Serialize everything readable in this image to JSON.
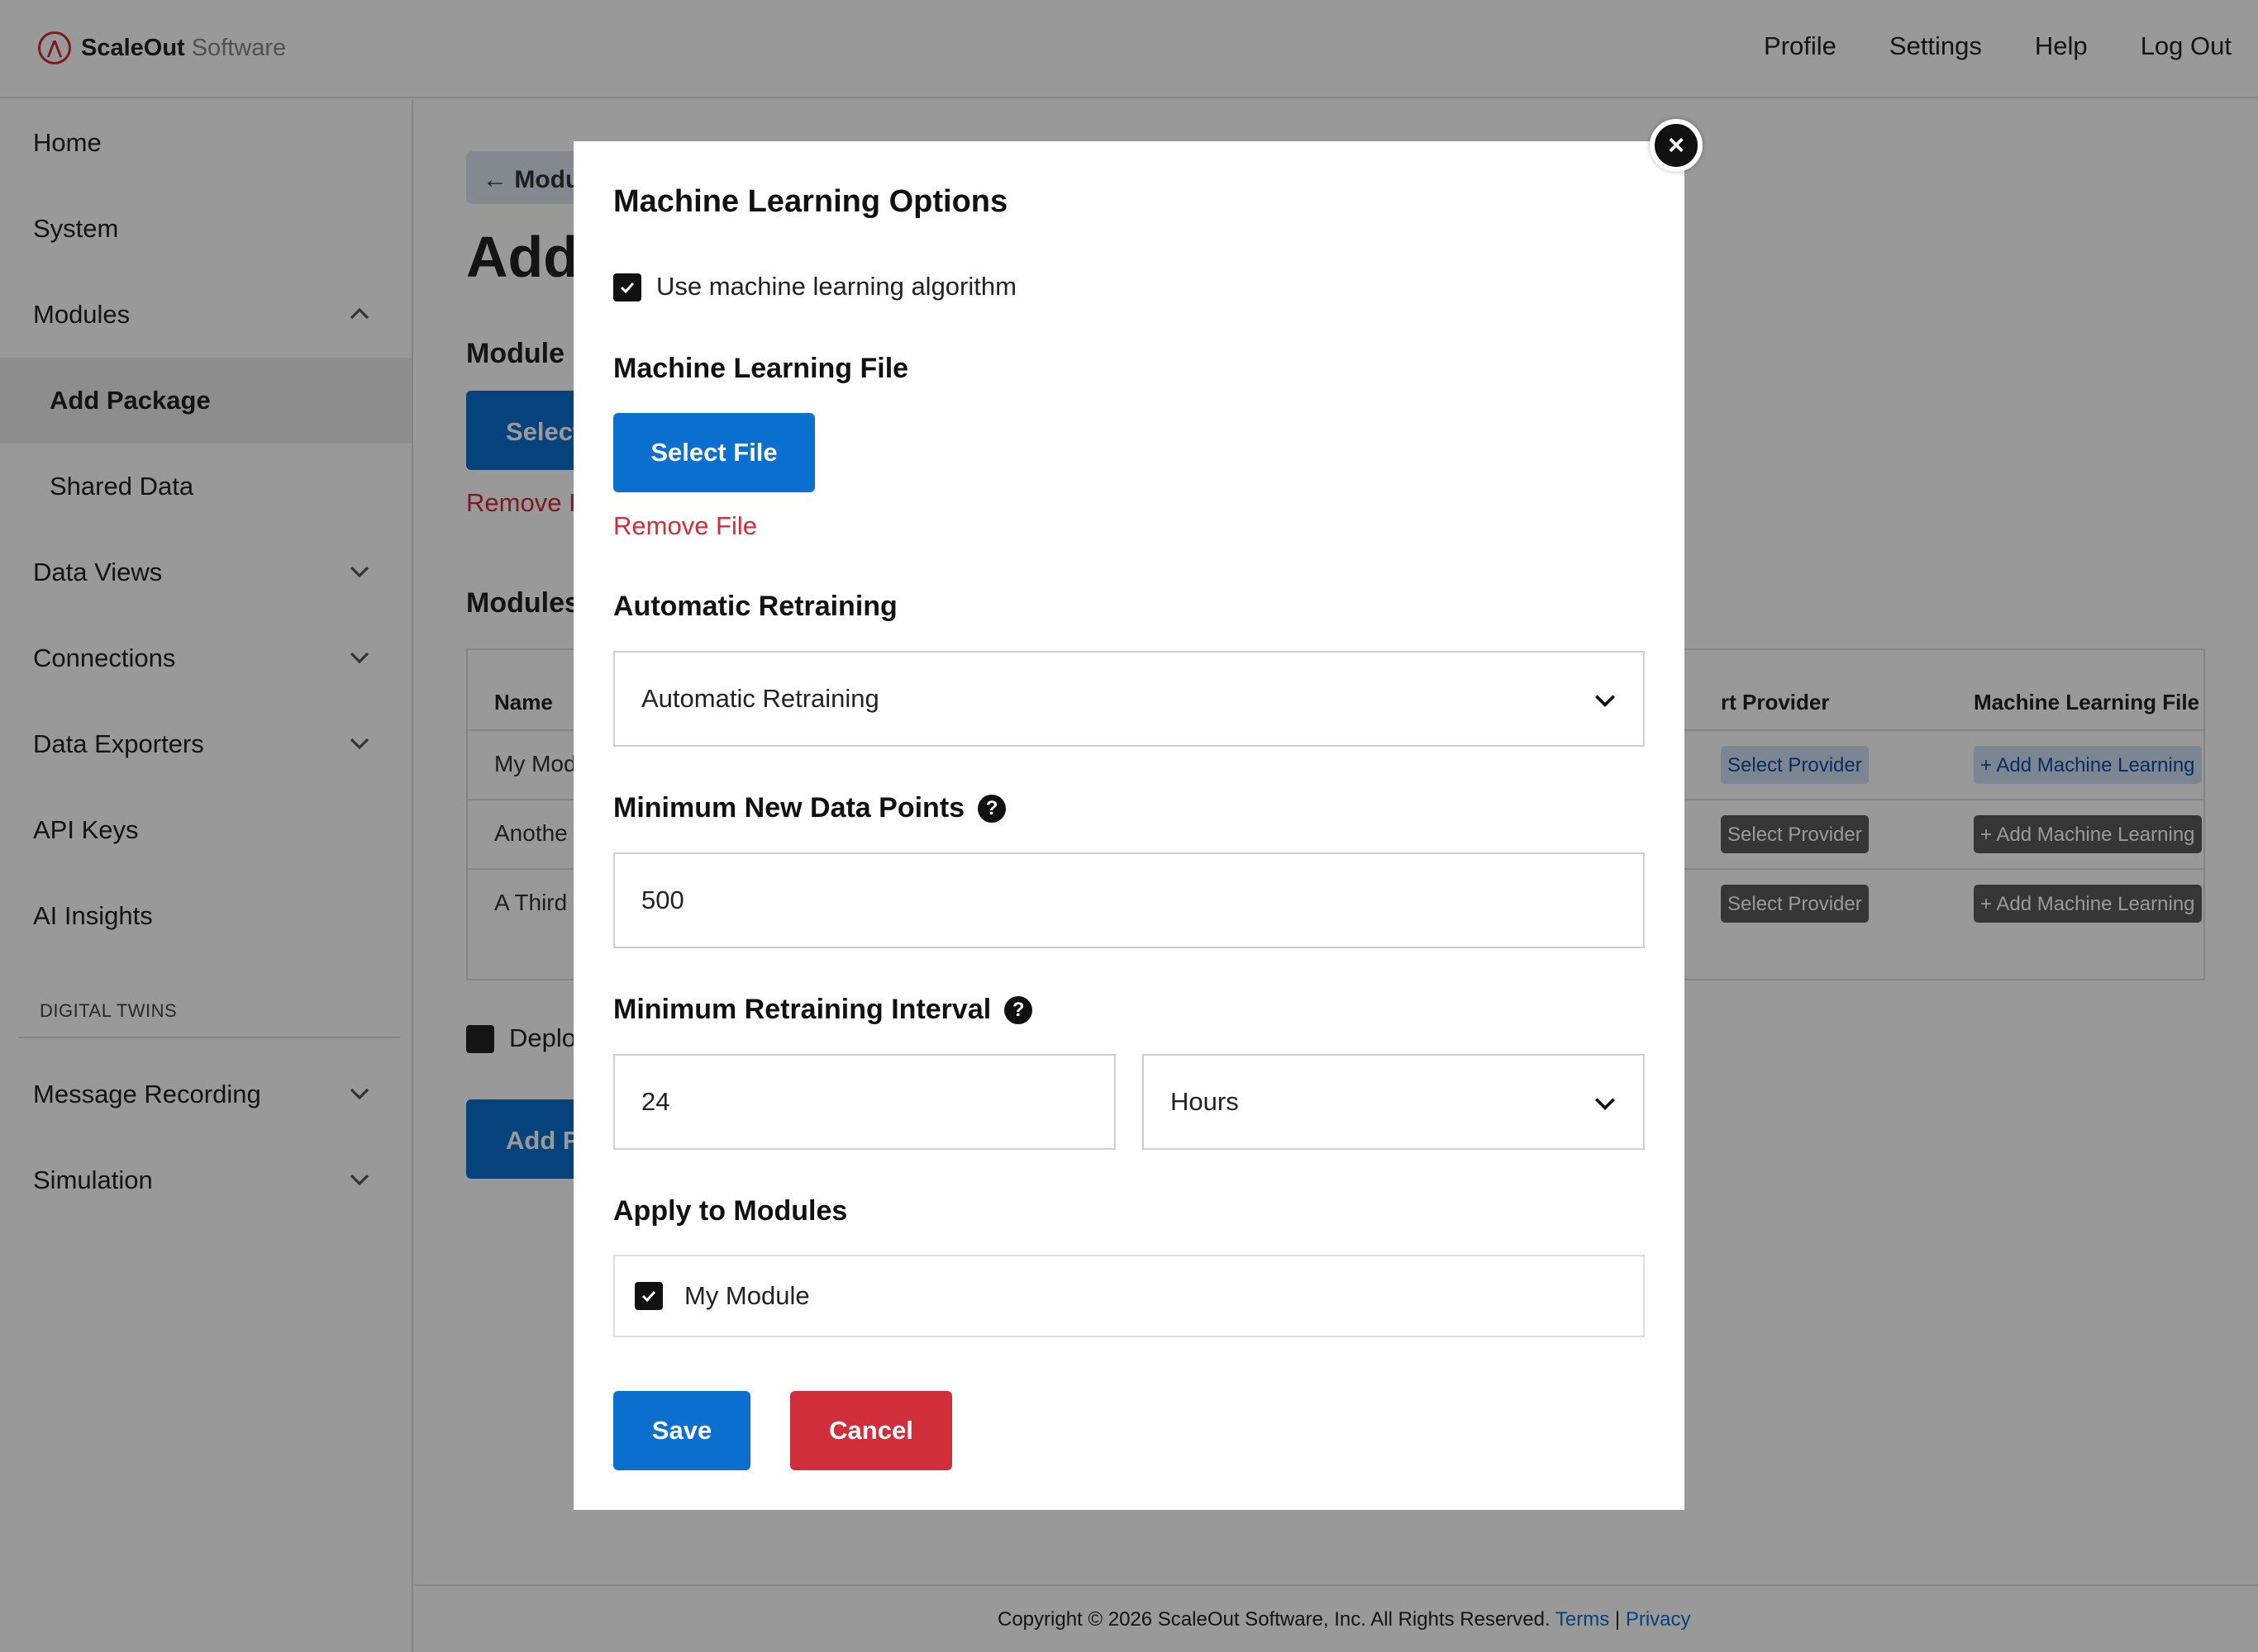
{
  "header": {
    "brand_bold": "ScaleOut",
    "brand_light": "Software",
    "nav": [
      "Profile",
      "Settings",
      "Help",
      "Log Out"
    ]
  },
  "sidebar": {
    "items": [
      {
        "label": "Home"
      },
      {
        "label": "System"
      },
      {
        "label": "Modules",
        "expanded": true
      },
      {
        "label": "Add Package",
        "active": true
      },
      {
        "label": "Shared Data"
      },
      {
        "label": "Data Views"
      },
      {
        "label": "Connections"
      },
      {
        "label": "Data Exporters"
      },
      {
        "label": "API Keys"
      },
      {
        "label": "AI Insights"
      }
    ],
    "section_label": "DIGITAL TWINS",
    "section_items": [
      {
        "label": "Message Recording"
      },
      {
        "label": "Simulation"
      }
    ]
  },
  "background": {
    "back_button": "Modu",
    "page_title": "Add",
    "module_heading": "Module",
    "select_button": "Select",
    "remove_link": "Remove I",
    "modules_heading": "Modules",
    "table": {
      "headers": [
        "Name",
        "rt Provider",
        "Machine Learning File"
      ],
      "rows": [
        {
          "name": "My Mod",
          "provider": "Select Provider",
          "ml": "+ Add Machine Learning"
        },
        {
          "name": "Anothe",
          "provider": "Select Provider",
          "ml": "+ Add Machine Learning"
        },
        {
          "name": "A Third",
          "provider": "Select Provider",
          "ml": "+ Add Machine Learning"
        }
      ]
    },
    "deploy_label": "Deplo",
    "add_button": "Add P"
  },
  "footer": {
    "text": "Copyright © 2026 ScaleOut Software, Inc. All Rights Reserved.",
    "terms": "Terms",
    "separator": "|",
    "privacy": "Privacy"
  },
  "modal": {
    "title": "Machine Learning Options",
    "use_ml_label": "Use machine learning algorithm",
    "use_ml_checked": true,
    "ml_file_heading": "Machine Learning File",
    "select_file_button": "Select File",
    "remove_file_link": "Remove File",
    "retraining_heading": "Automatic Retraining",
    "retraining_value": "Automatic Retraining",
    "min_points_heading": "Minimum New Data Points",
    "min_points_value": "500",
    "min_interval_heading": "Minimum Retraining Interval",
    "interval_value": "24",
    "interval_unit": "Hours",
    "apply_heading": "Apply to Modules",
    "module_option": "My Module",
    "module_option_checked": true,
    "save_button": "Save",
    "cancel_button": "Cancel",
    "close_symbol": "×",
    "help_symbol": "?"
  },
  "colors": {
    "primary": "#0a6fcf",
    "danger": "#cf2e3a",
    "overlay": "rgba(0,0,0,0.40)"
  }
}
